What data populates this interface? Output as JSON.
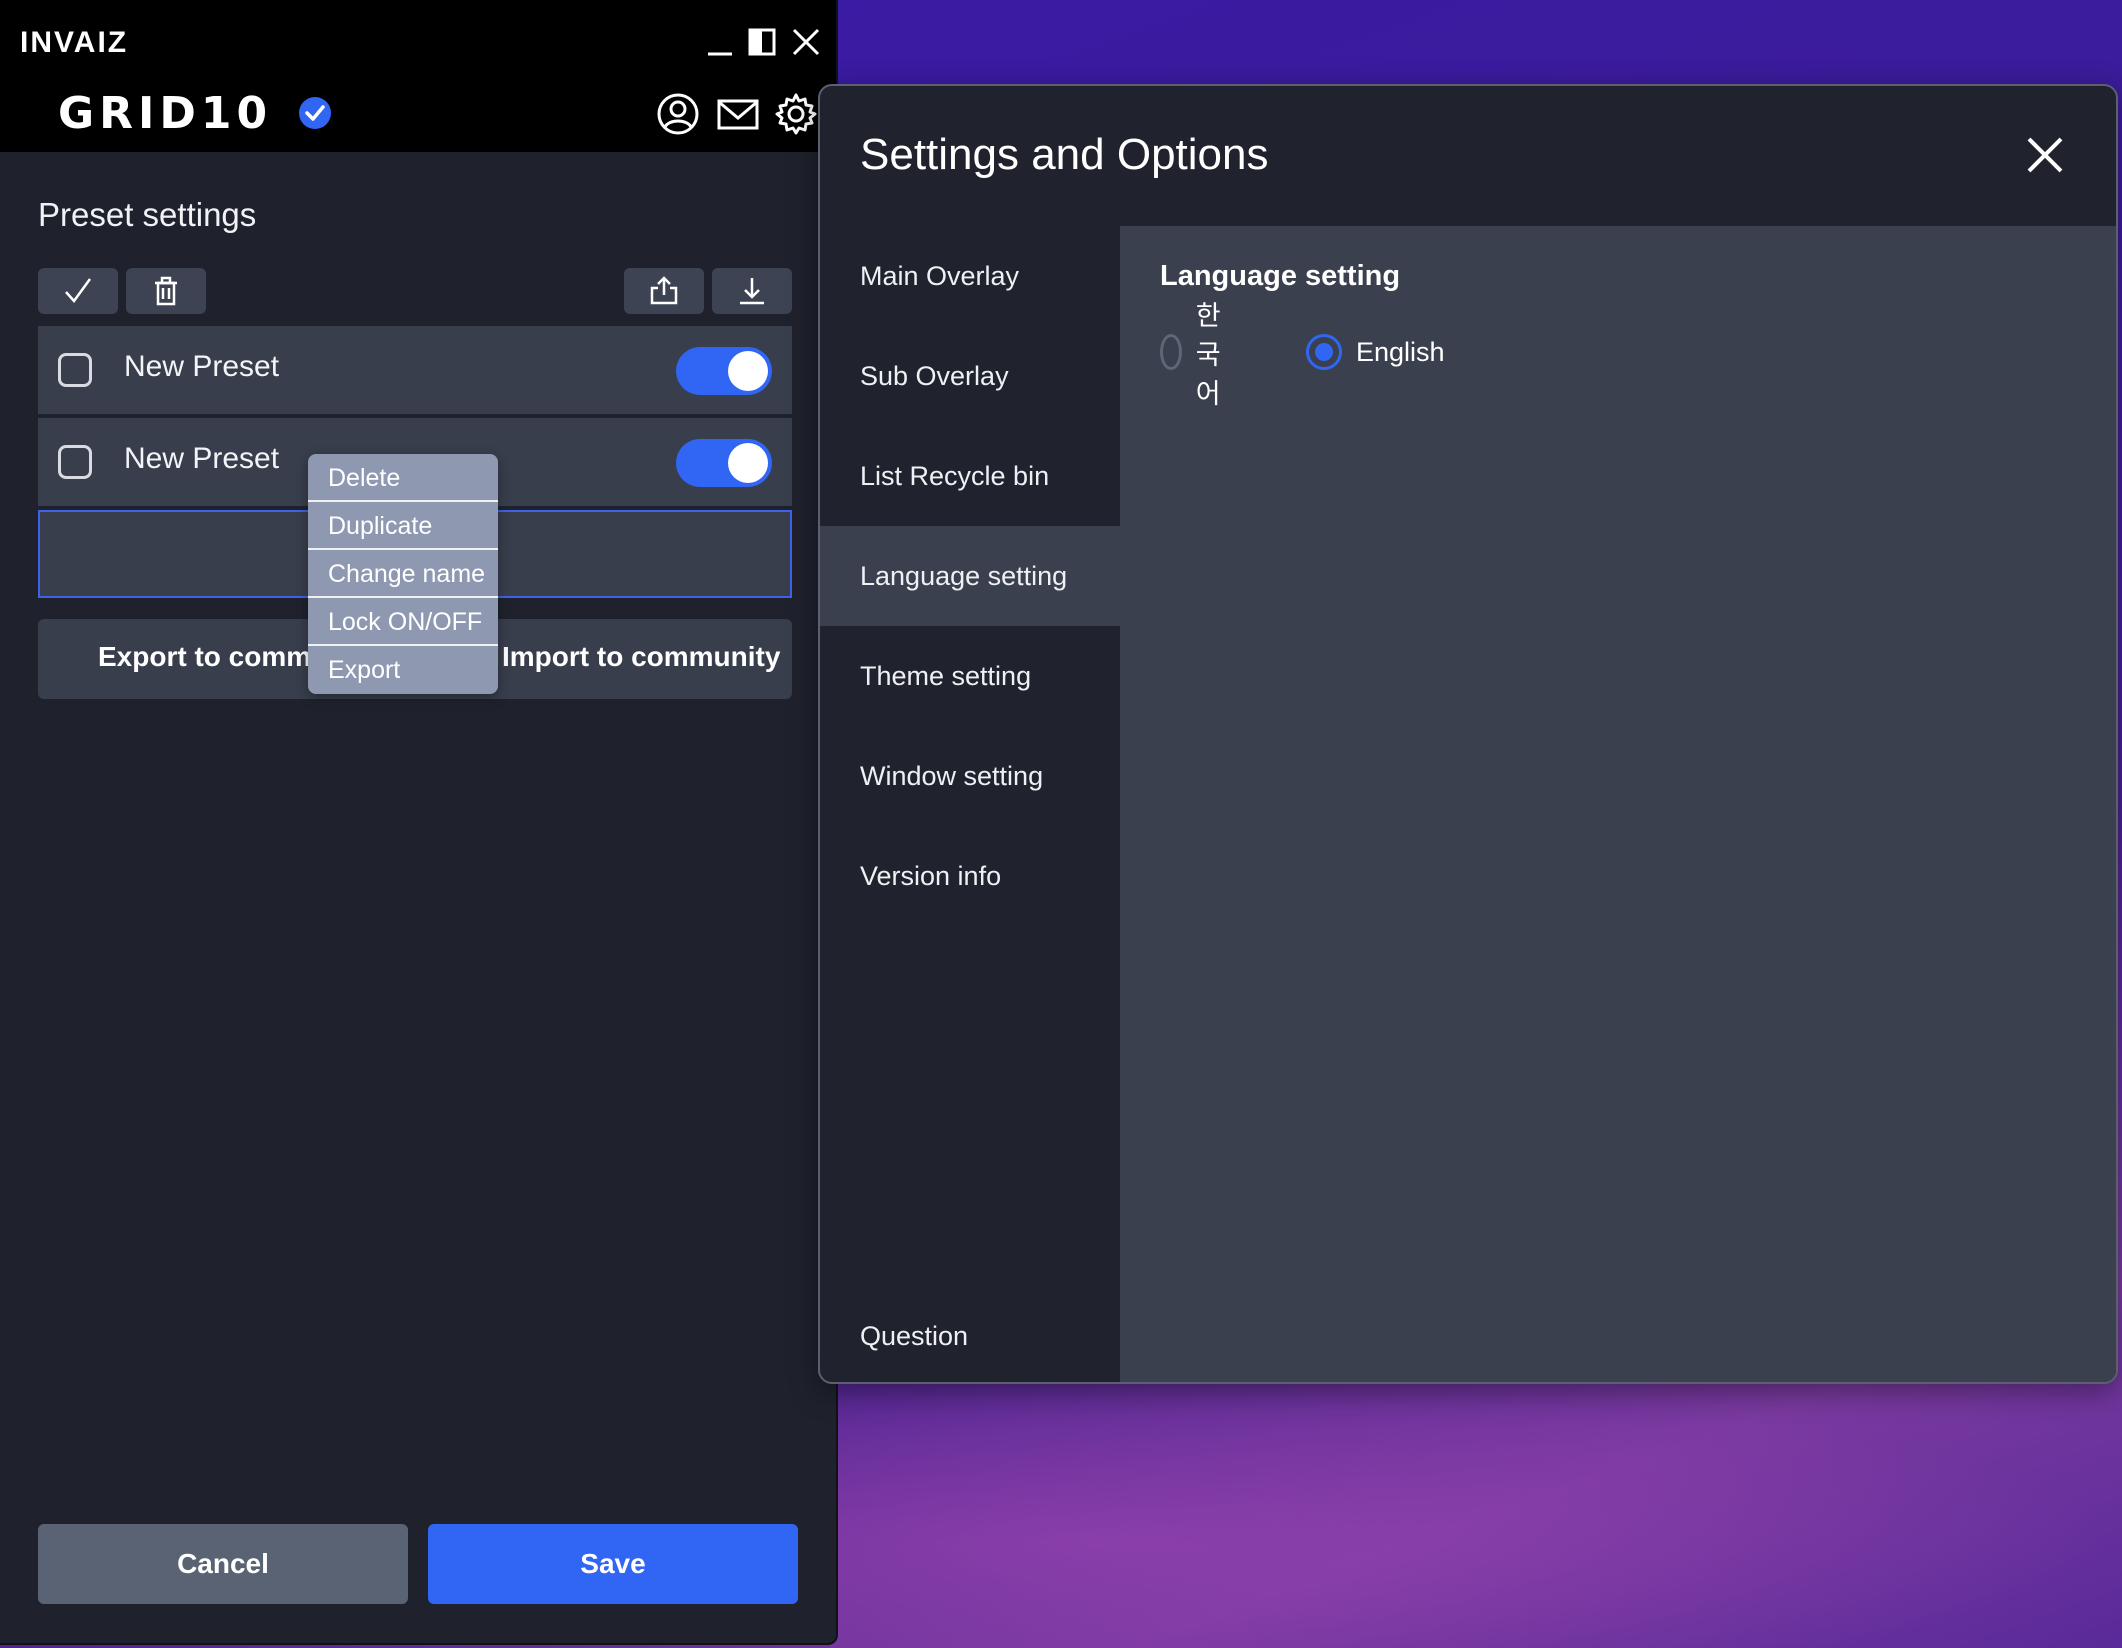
{
  "app": {
    "brand": "INVAIZ",
    "product": "GRID10"
  },
  "preset": {
    "title": "Preset settings",
    "rows": [
      {
        "name": "New Preset",
        "enabled": true
      },
      {
        "name": "New Preset",
        "enabled": true
      }
    ],
    "export_community": "Export to community",
    "import_community": "Import to community"
  },
  "context_menu": {
    "items": [
      "Delete",
      "Duplicate",
      "Change name",
      "Lock ON/OFF",
      "Export"
    ]
  },
  "footer": {
    "cancel": "Cancel",
    "save": "Save"
  },
  "settings": {
    "title": "Settings and Options",
    "nav": [
      "Main Overlay",
      "Sub Overlay",
      "List Recycle bin",
      "Language setting",
      "Theme setting",
      "Window setting",
      "Version info",
      "Question"
    ],
    "active_nav": "Language setting",
    "panel_title": "Language setting",
    "languages": [
      {
        "label": "한국어",
        "checked": false
      },
      {
        "label": "English",
        "checked": true
      }
    ]
  },
  "colors": {
    "accent": "#3166f5",
    "window_bg": "#1f222d",
    "row_bg": "#383e4c",
    "menu_bg": "#8e99b1"
  }
}
